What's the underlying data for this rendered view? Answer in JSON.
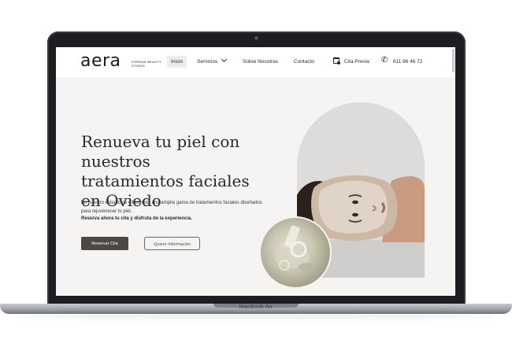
{
  "laptop": {
    "model_label": "MacBook Air"
  },
  "nav": {
    "logo": "aera",
    "logo_tagline": "KOREAN BEAUTY STUDIO",
    "items": [
      {
        "label": "Inicio",
        "active": true
      },
      {
        "label": "Servicios"
      },
      {
        "label": "Sobre Nosotras"
      },
      {
        "label": "Contacto"
      }
    ],
    "appointment_label": "Cita Previa",
    "phone": "611 86 46 72"
  },
  "hero": {
    "title": "Renueva tu piel con nuestros tratamientos faciales en Oviedo",
    "body": "En nuestro estudio, te ofrecemos una amplia gama de tratamientos faciales diseñados para rejuvenecer tu piel.",
    "emphasis": "Reserva ahora tu cita y disfruta de la experiencia.",
    "primary_button": "Reservar Cita",
    "secondary_button": "Quiero Información"
  },
  "colors": {
    "page_bg": "#f5f4f2",
    "primary_button": "#4e4845",
    "text_dark": "#2a2725",
    "laptop_bezel": "#1d1e21"
  }
}
